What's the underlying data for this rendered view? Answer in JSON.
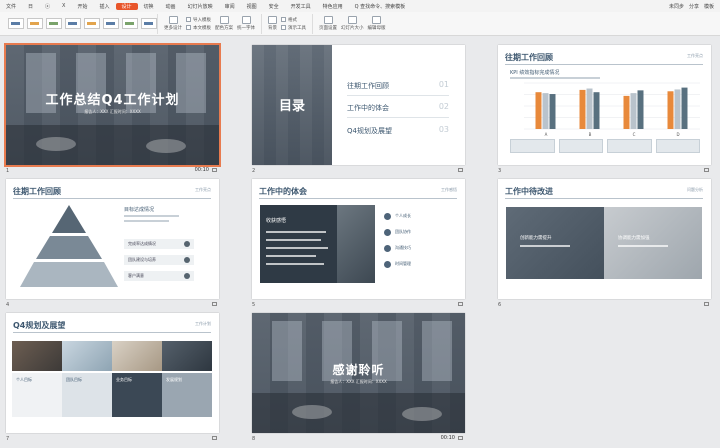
{
  "menu": {
    "items": [
      "文件",
      "日",
      "ⓧ",
      "Ⅹ",
      "开始",
      "插入",
      "设计",
      "切换",
      "动画",
      "幻灯片放映",
      "审阅",
      "视图",
      "安全",
      "开发工具",
      "特色应用"
    ],
    "active_index": 6,
    "search_placeholder": "Q 查找命令、搜索模板",
    "right_items": [
      "未同步",
      "分享",
      "模板"
    ]
  },
  "ribbon": {
    "buttons": [
      {
        "label": "更多设计",
        "icon": "design-icon"
      },
      {
        "label": "导入模板",
        "icon": "import-icon"
      },
      {
        "label": "本文模板",
        "icon": "template-icon"
      },
      {
        "label": "配色方案",
        "icon": "palette-icon"
      },
      {
        "label": "统一字体",
        "icon": "font-icon"
      },
      {
        "label": "背景",
        "icon": "background-icon"
      },
      {
        "label": "格式",
        "icon": "format-icon"
      },
      {
        "label": "演示工具",
        "icon": "tools-icon"
      },
      {
        "label": "页面设置",
        "icon": "page-setup-icon"
      },
      {
        "label": "幻灯片大小",
        "icon": "slide-size-icon"
      },
      {
        "label": "编辑母版",
        "icon": "master-icon"
      }
    ]
  },
  "slides": [
    {
      "num": "1",
      "title": "工作总结Q4工作计划",
      "sub": "报告人：XXX  汇报时间：XXXX",
      "duration": "00:10"
    },
    {
      "num": "2",
      "title": "目录",
      "items": [
        {
          "label": "往期工作回顾",
          "no": "01"
        },
        {
          "label": "工作中的体会",
          "no": "02"
        },
        {
          "label": "Q4规划及展望",
          "no": "03"
        }
      ]
    },
    {
      "num": "3",
      "title": "往期工作回顾",
      "tag": "工作亮点",
      "chart_title": "KPI 绩效指标完成情况"
    },
    {
      "num": "4",
      "title": "往期工作回顾",
      "tag": "工作亮点",
      "pyr_label": "目标达成情况",
      "chips": [
        "完成率达成情况",
        "团队建设与培养",
        "客户满意"
      ]
    },
    {
      "num": "5",
      "title": "工作中的体会",
      "tag": "工作感悟",
      "dark_title": "收获感悟",
      "points": [
        "个人成长",
        "团队协作",
        "沟通技巧",
        "时间管理"
      ]
    },
    {
      "num": "6",
      "title": "工作中待改进",
      "tag": "问题分析",
      "left_text": "创新能力需提升",
      "right_text": "协调能力需加强"
    },
    {
      "num": "7",
      "title": "Q4规划及展望",
      "tag": "工作计划",
      "cols": [
        "个人目标",
        "团队目标",
        "业务目标",
        "发展规划"
      ]
    },
    {
      "num": "8",
      "title": "感谢聆听",
      "sub": "报告人：XXX  汇报时间：XXXX",
      "duration": "00:10"
    }
  ],
  "chart_data": {
    "type": "bar",
    "title": "KPI 绩效指标完成情况",
    "categories": [
      "A",
      "B",
      "C",
      "D"
    ],
    "series": [
      {
        "name": "",
        "values": [
          80,
          85,
          72,
          82
        ],
        "color": "#e8893b"
      },
      {
        "name": "",
        "values": [
          78,
          88,
          78,
          86
        ],
        "color": "#b9c3cc"
      },
      {
        "name": "",
        "values": [
          76,
          80,
          84,
          90
        ],
        "color": "#58707f"
      }
    ],
    "ylim": [
      0,
      100
    ]
  }
}
